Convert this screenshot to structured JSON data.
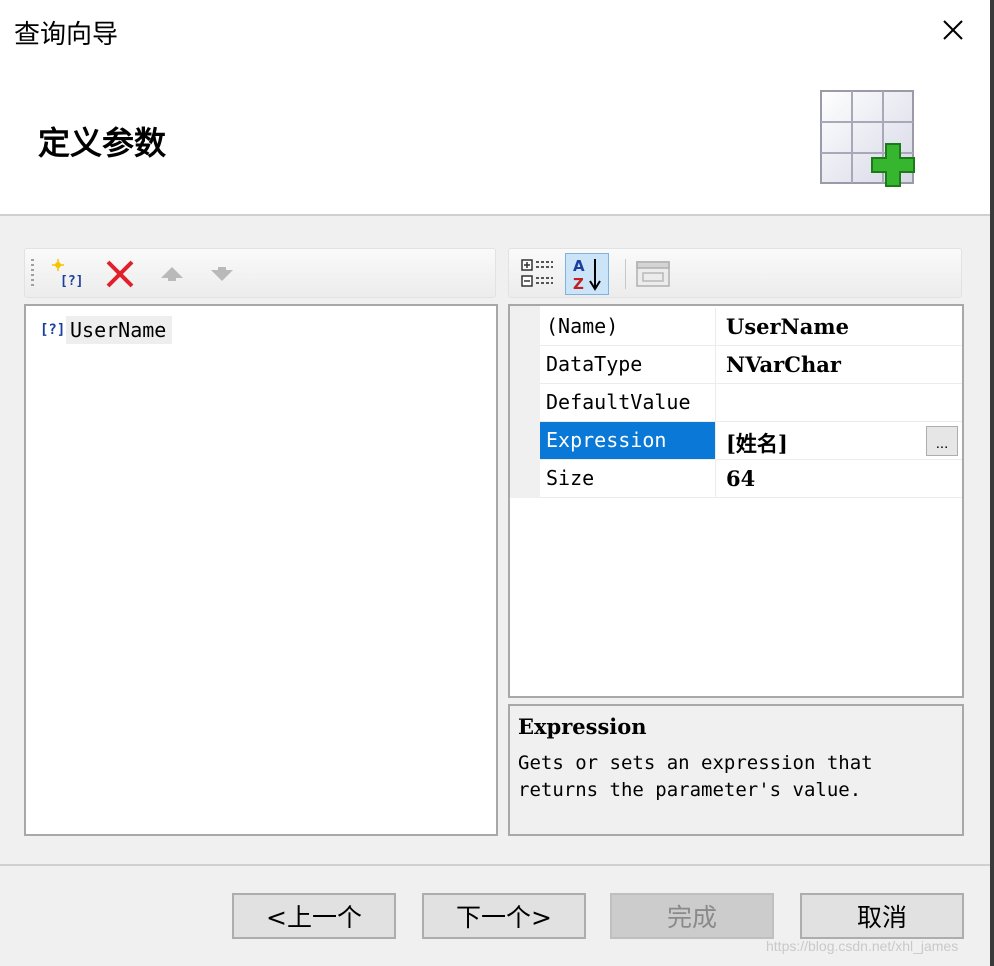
{
  "window": {
    "title": "查询向导"
  },
  "header": {
    "heading": "定义参数",
    "icon": "table-add-icon"
  },
  "left_toolbar": {
    "buttons": [
      {
        "name": "add-parameter",
        "icon": "new-parameter-icon"
      },
      {
        "name": "delete",
        "icon": "delete-x-icon",
        "color": "#e0202a"
      },
      {
        "name": "move-up",
        "icon": "arrow-up-icon"
      },
      {
        "name": "move-down",
        "icon": "arrow-down-icon"
      }
    ]
  },
  "parameters": [
    {
      "icon_text": "[?]",
      "label": "UserName"
    }
  ],
  "right_toolbar": {
    "buttons": [
      {
        "name": "categorized",
        "icon": "categorized-view-icon"
      },
      {
        "name": "alphabetical",
        "icon": "sort-az-icon",
        "active": true
      },
      {
        "name": "property-pages",
        "icon": "property-pages-icon",
        "enabled": false
      }
    ]
  },
  "properties": [
    {
      "name": "(Name)",
      "value": "UserName"
    },
    {
      "name": "DataType",
      "value": "NVarChar"
    },
    {
      "name": "DefaultValue",
      "value": ""
    },
    {
      "name": "Expression",
      "value": "[姓名]",
      "selected": true,
      "has_editor": true,
      "editor_label": "..."
    },
    {
      "name": "Size",
      "value": "64"
    }
  ],
  "description": {
    "title": "Expression",
    "text": "Gets or sets an expression that returns the parameter's value."
  },
  "buttons": {
    "prev": "<上一个",
    "next": "下一个>",
    "finish": "完成",
    "cancel": "取消"
  },
  "watermark": "https://blog.csdn.net/xhl_james",
  "colors": {
    "selection": "#0a78d7",
    "accent_green": "#36b52f"
  }
}
